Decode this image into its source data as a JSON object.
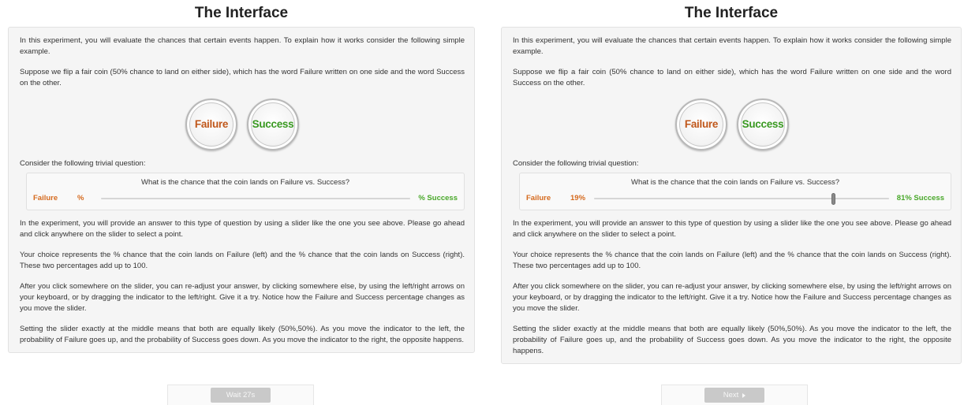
{
  "left": {
    "heading": "The Interface",
    "para1": "In this experiment, you will evaluate the chances that certain events happen. To explain how it works consider the following simple example.",
    "para2": "Suppose we flip a fair coin (50% chance to land on either side), which has the word Failure written on one side and the word Success on the other.",
    "coin_failure": "Failure",
    "coin_success": "Success",
    "para3": "Consider the following trivial question:",
    "question": "What is the chance that the coin lands on Failure vs. Success?",
    "failure_label": "Failure",
    "failure_pct": "%",
    "success_text": "% Success",
    "para4": "In the experiment, you will provide an answer to this type of question by using a slider like the one you see above. Please go ahead and click anywhere on the slider to select a point.",
    "para5": "Your choice represents the % chance that the coin lands on Failure (left) and the % chance that the coin lands on Success (right). These two percentages add up to 100.",
    "para6": "After you click somewhere on the slider, you can re-adjust your answer, by clicking somewhere else, by using the left/right arrows on your keyboard, or by dragging the indicator to the left/right. Give it a try. Notice how the Failure and Success percentage changes as you move the slider.",
    "para7": "Setting the slider exactly at the middle means that both are equally likely (50%,50%). As you move the indicator to the left, the probability of Failure goes up, and the probability of Success goes down. As you move the indicator to the right, the opposite happens.",
    "button_label": "Wait 27s"
  },
  "right": {
    "heading": "The Interface",
    "para1": "In this experiment, you will evaluate the chances that certain events happen. To explain how it works consider the following simple example.",
    "para2": "Suppose we flip a fair coin (50% chance to land on either side), which has the word Failure written on one side and the word Success on the other.",
    "coin_failure": "Failure",
    "coin_success": "Success",
    "para3": "Consider the following trivial question:",
    "question": "What is the chance that the coin lands on Failure vs. Success?",
    "failure_label": "Failure",
    "failure_pct": "19%",
    "success_text": "81% Success",
    "slider_value": 0.81,
    "para4": "In the experiment, you will provide an answer to this type of question by using a slider like the one you see above. Please go ahead and click anywhere on the slider to select a point.",
    "para5": "Your choice represents the % chance that the coin lands on Failure (left) and the % chance that the coin lands on Success (right). These two percentages add up to 100.",
    "para6": "After you click somewhere on the slider, you can re-adjust your answer, by clicking somewhere else, by using the left/right arrows on your keyboard, or by dragging the indicator to the left/right. Give it a try. Notice how the Failure and Success percentage changes as you move the slider.",
    "para7": "Setting the slider exactly at the middle means that both are equally likely (50%,50%). As you move the indicator to the left, the probability of Failure goes up, and the probability of Success goes down. As you move the indicator to the right, the opposite happens.",
    "button_label": "Next",
    "button_icon": "chevron-right-icon"
  }
}
